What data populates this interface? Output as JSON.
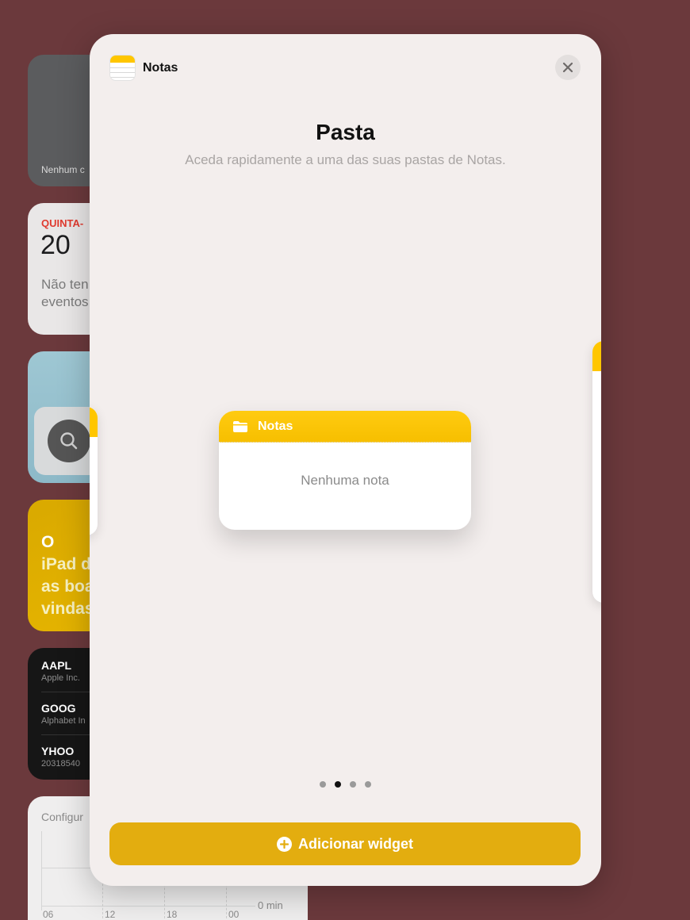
{
  "background_widgets": {
    "gray": {
      "text": "Nenhum c"
    },
    "calendar": {
      "day": "QUINTA-",
      "date": "20",
      "events_line1": "Não ten",
      "events_line2": "eventos"
    },
    "tips": {
      "line1": "O",
      "line2": "iPad d",
      "line3": "as boa",
      "line4": "vindas"
    },
    "stocks": [
      {
        "symbol": "AAPL",
        "name": "Apple Inc."
      },
      {
        "symbol": "GOOG",
        "name": "Alphabet In"
      },
      {
        "symbol": "YHOO",
        "name": "20318540"
      }
    ],
    "screen_time": {
      "label": "Configur",
      "ticks": [
        "06",
        "12",
        "18",
        "00"
      ],
      "axis_label": "0 min"
    }
  },
  "sheet": {
    "app_name": "Notas",
    "title": "Pasta",
    "subtitle": "Aceda rapidamente a uma das suas pastas de Notas.",
    "preview": {
      "folder_title": "Notas",
      "empty_text": "Nenhuma nota"
    },
    "pager": {
      "count": 4,
      "active": 1
    },
    "add_button_label": "Adicionar widget"
  },
  "colors": {
    "accent": "#e3ad0f",
    "notes_yellow": "#ffc600",
    "background": "#6b393c"
  }
}
